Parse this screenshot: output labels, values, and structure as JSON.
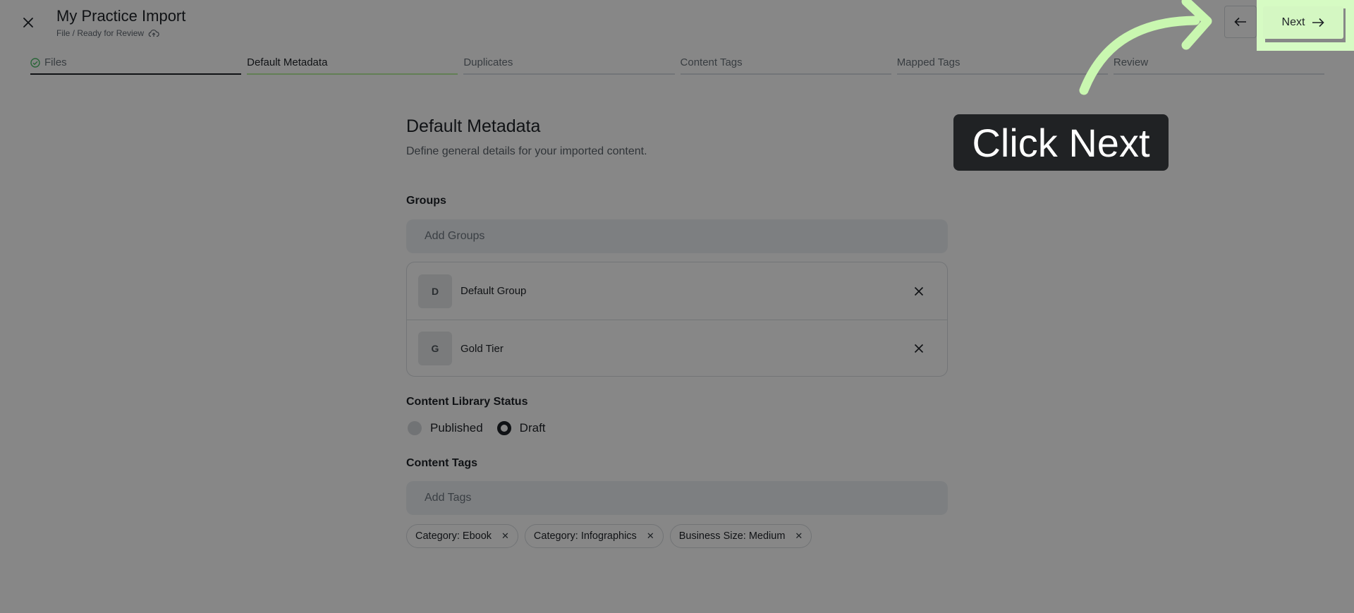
{
  "header": {
    "title": "My Practice Import",
    "subtitle": "File / Ready for Review"
  },
  "stepper": [
    {
      "label": "Files",
      "state": "done"
    },
    {
      "label": "Default Metadata",
      "state": "current"
    },
    {
      "label": "Duplicates",
      "state": "upcoming"
    },
    {
      "label": "Content Tags",
      "state": "upcoming"
    },
    {
      "label": "Mapped Tags",
      "state": "upcoming"
    },
    {
      "label": "Review",
      "state": "upcoming"
    }
  ],
  "actions": {
    "next_label": "Next"
  },
  "main": {
    "title": "Default Metadata",
    "description": "Define general details for your imported content.",
    "groups_label": "Groups",
    "groups_placeholder": "Add Groups",
    "groups": [
      {
        "initial": "D",
        "name": "Default Group"
      },
      {
        "initial": "G",
        "name": "Gold Tier"
      }
    ],
    "status_label": "Content Library Status",
    "status_options": [
      {
        "label": "Published",
        "selected": false
      },
      {
        "label": "Draft",
        "selected": true
      }
    ],
    "tags_label": "Content Tags",
    "tags_placeholder": "Add Tags",
    "tags": [
      "Category: Ebook",
      "Category: Infographics",
      "Business Size: Medium"
    ]
  },
  "tooltip": {
    "text": "Click Next"
  },
  "colors": {
    "accent": "#b9f0a0",
    "highlight": "#d6fbc3",
    "overlay": "rgba(0,0,0,0.47)"
  }
}
